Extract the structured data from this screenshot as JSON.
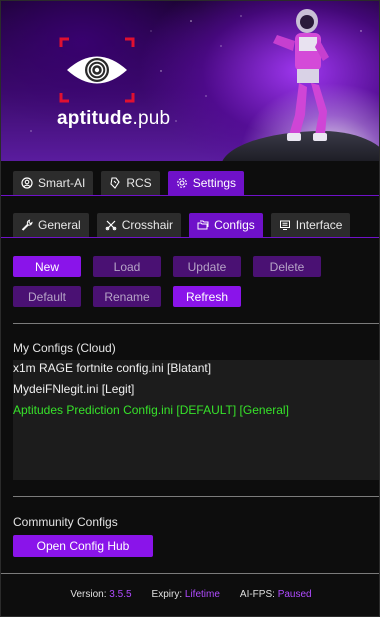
{
  "brand": {
    "logo_text": "aptitude",
    "logo_suffix": ".pub"
  },
  "main_tabs": [
    {
      "label": "Smart-AI",
      "icon": "user-circle-icon",
      "active": false
    },
    {
      "label": "RCS",
      "icon": "recoil-icon",
      "active": false
    },
    {
      "label": "Settings",
      "icon": "gear-icon",
      "active": true
    }
  ],
  "sub_tabs": [
    {
      "label": "General",
      "icon": "wrench-icon",
      "active": false
    },
    {
      "label": "Crosshair",
      "icon": "crosshair-icon",
      "active": false
    },
    {
      "label": "Configs",
      "icon": "folders-icon",
      "active": true
    },
    {
      "label": "Interface",
      "icon": "monitor-icon",
      "active": false
    }
  ],
  "actions_row1": [
    {
      "label": "New",
      "enabled": true
    },
    {
      "label": "Load",
      "enabled": false
    },
    {
      "label": "Update",
      "enabled": false
    },
    {
      "label": "Delete",
      "enabled": false
    }
  ],
  "actions_row2": [
    {
      "label": "Default",
      "enabled": false
    },
    {
      "label": "Rename",
      "enabled": false
    },
    {
      "label": "Refresh",
      "enabled": true
    }
  ],
  "my_configs": {
    "title": "My Configs (Cloud)",
    "items": [
      {
        "text": "x1m RAGE fortnite config.ini  [Blatant]",
        "is_default": false
      },
      {
        "text": "MydeiFNlegit.ini  [Legit]",
        "is_default": false
      },
      {
        "text": "Aptitudes Prediction Config.ini [DEFAULT]  [General]",
        "is_default": true
      }
    ]
  },
  "community": {
    "title": "Community Configs",
    "button": "Open Config Hub"
  },
  "footer": {
    "version_label": "Version:",
    "version_value": "3.5.5",
    "expiry_label": "Expiry:",
    "expiry_value": "Lifetime",
    "aifps_label": "AI-FPS:",
    "aifps_value": "Paused"
  },
  "colors": {
    "accent": "#8a14ea",
    "active_tab": "#6f11c9",
    "default_config": "#37e22a",
    "footer_value": "#b04bff"
  }
}
